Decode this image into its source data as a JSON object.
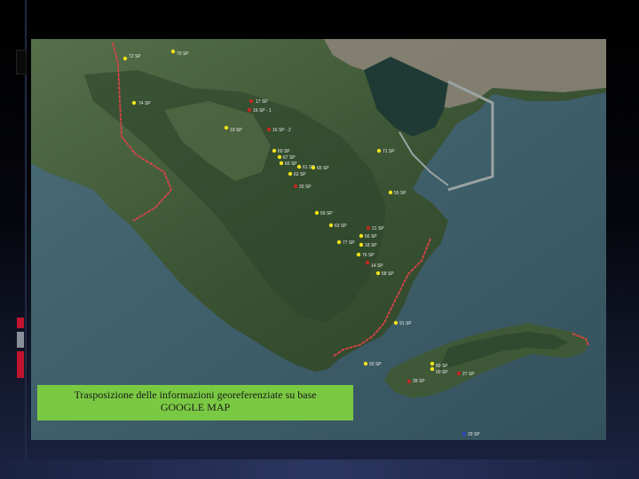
{
  "caption": {
    "line1": "Trasposizione delle informazioni georeferenziate su base",
    "line2": "GOOGLE MAP"
  },
  "colors": {
    "sea": "#3b5a66",
    "land": "#3e5636",
    "caption_bg": "#7ac943",
    "marker_yellow": "#f2e21a",
    "marker_red": "#c2271f",
    "path_red": "#d9434a",
    "accent_red": "#c0142f",
    "accent_gray": "#8a8f99"
  },
  "markers": [
    {
      "label": "72 SP",
      "type": "yellow"
    },
    {
      "label": "70 SP",
      "type": "yellow"
    },
    {
      "label": "74 SP",
      "type": "yellow"
    },
    {
      "label": "17 SP",
      "type": "red"
    },
    {
      "label": "16 SP - 1",
      "type": "red"
    },
    {
      "label": "19 SP",
      "type": "yellow"
    },
    {
      "label": "16 SP - 2",
      "type": "red"
    },
    {
      "label": "71 SP",
      "type": "yellow"
    },
    {
      "label": "60 SP",
      "type": "yellow"
    },
    {
      "label": "67 SP",
      "type": "yellow"
    },
    {
      "label": "66 SP",
      "type": "yellow"
    },
    {
      "label": "61 SP",
      "type": "yellow"
    },
    {
      "label": "65 SP",
      "type": "yellow"
    },
    {
      "label": "62 SP",
      "type": "yellow"
    },
    {
      "label": "20 SP",
      "type": "red"
    },
    {
      "label": "55 SP",
      "type": "yellow"
    },
    {
      "label": "59 SP",
      "type": "yellow"
    },
    {
      "label": "63 SP",
      "type": "yellow"
    },
    {
      "label": "21 SP",
      "type": "red"
    },
    {
      "label": "56 SP",
      "type": "yellow"
    },
    {
      "label": "77 SP",
      "type": "yellow"
    },
    {
      "label": "18 SP",
      "type": "yellow"
    },
    {
      "label": "76 SP",
      "type": "yellow"
    },
    {
      "label": "14 SP",
      "type": "red"
    },
    {
      "label": "58 SP",
      "type": "yellow"
    },
    {
      "label": "91 SP",
      "type": "yellow"
    },
    {
      "label": "93 SP",
      "type": "yellow"
    },
    {
      "label": "89 SP",
      "type": "yellow"
    },
    {
      "label": "90 SP",
      "type": "yellow"
    },
    {
      "label": "27 SP",
      "type": "red"
    },
    {
      "label": "28 SP",
      "type": "red"
    },
    {
      "label": "29 SP",
      "type": "blue"
    }
  ]
}
